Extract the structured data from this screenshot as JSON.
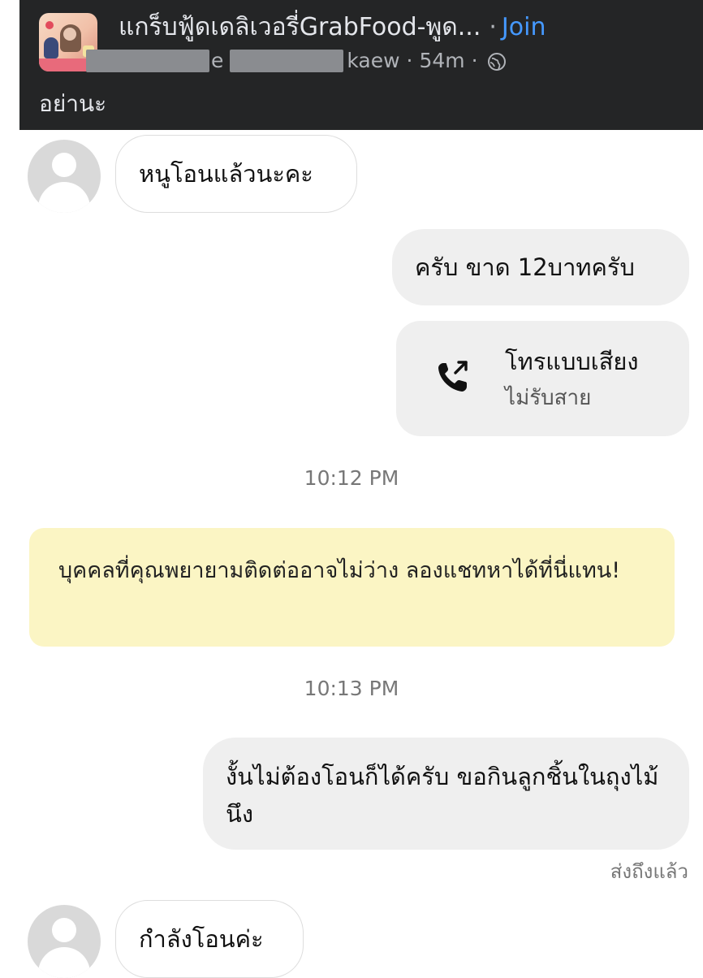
{
  "post_header": {
    "group_name": "แกร็บฟู้ดเดลิเวอรี่GrabFood-พูด...",
    "separator": "·",
    "join_label": "Join",
    "author_suffix_1": "e",
    "author_suffix_2": "kaew",
    "time_ago": "54m",
    "meta_separator": "·",
    "post_text": "อย่านะ",
    "group_thumb_icon": "group-photo-thumbnail",
    "audience_icon": "globe-icon"
  },
  "chat": {
    "messages": [
      {
        "side": "incoming",
        "text": "หนูโอนแล้วนะคะ"
      },
      {
        "side": "outgoing",
        "text": "ครับ ขาด 12บาทครับ"
      },
      {
        "side": "outgoing",
        "type": "call",
        "title": "โทรแบบเสียง",
        "subtitle": "ไม่รับสาย",
        "icon": "missed-outgoing-call-icon"
      },
      {
        "side": "system",
        "type": "timestamp",
        "text": "10:12 PM"
      },
      {
        "side": "system",
        "type": "notice",
        "text": "บุคคลที่คุณพยายามติดต่ออาจไม่ว่าง ลองแชทหาได้ที่นี่แทน!"
      },
      {
        "side": "system",
        "type": "timestamp",
        "text": "10:13 PM"
      },
      {
        "side": "outgoing",
        "text": "งั้นไม่ต้องโอนก็ได้ครับ ขอกินลูกชิ้นในถุงไม้นึง"
      },
      {
        "side": "status",
        "text": "ส่งถึงแล้ว"
      },
      {
        "side": "incoming",
        "text": "กำลังโอนค่ะ"
      }
    ]
  },
  "colors": {
    "header_bg": "#242526",
    "join_link": "#4599ff",
    "outgoing_bubble": "#efefef",
    "notice_bg": "#fbf5c4"
  }
}
